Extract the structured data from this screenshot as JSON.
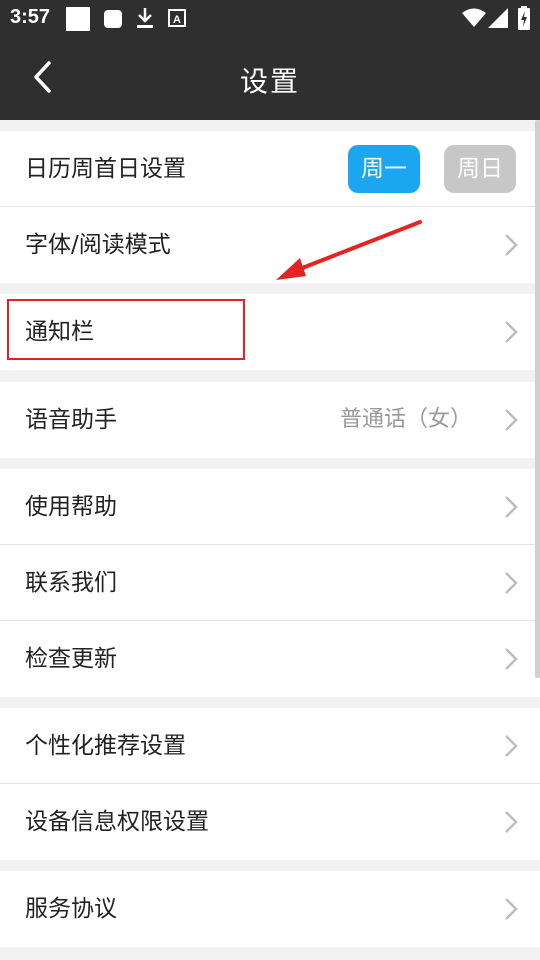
{
  "status_bar": {
    "time": "3:57",
    "icons": [
      "square-notification-icon",
      "rounded-square-icon",
      "download-icon",
      "a-notification-icon",
      "wifi-icon",
      "signal-icon",
      "battery-charging-icon"
    ]
  },
  "header": {
    "title": "设置",
    "back_icon": "chevron-left-icon"
  },
  "calendar_row": {
    "label": "日历周首日设置",
    "options": [
      "周一",
      "周日"
    ],
    "selected": "周一",
    "selected_color": "#1aa7f0",
    "unselected_color": "#c7c7c7"
  },
  "rows": {
    "font_mode": "字体/阅读模式",
    "notification_bar": "通知栏",
    "voice_assistant": "语音助手",
    "voice_assistant_value": "普通话（女）",
    "help": "使用帮助",
    "contact_us": "联系我们",
    "check_update": "检查更新",
    "personalized_recommend": "个性化推荐设置",
    "device_permissions": "设备信息权限设置",
    "service_agreement": "服务协议"
  },
  "annotation": {
    "highlight_color": "#e62222"
  }
}
